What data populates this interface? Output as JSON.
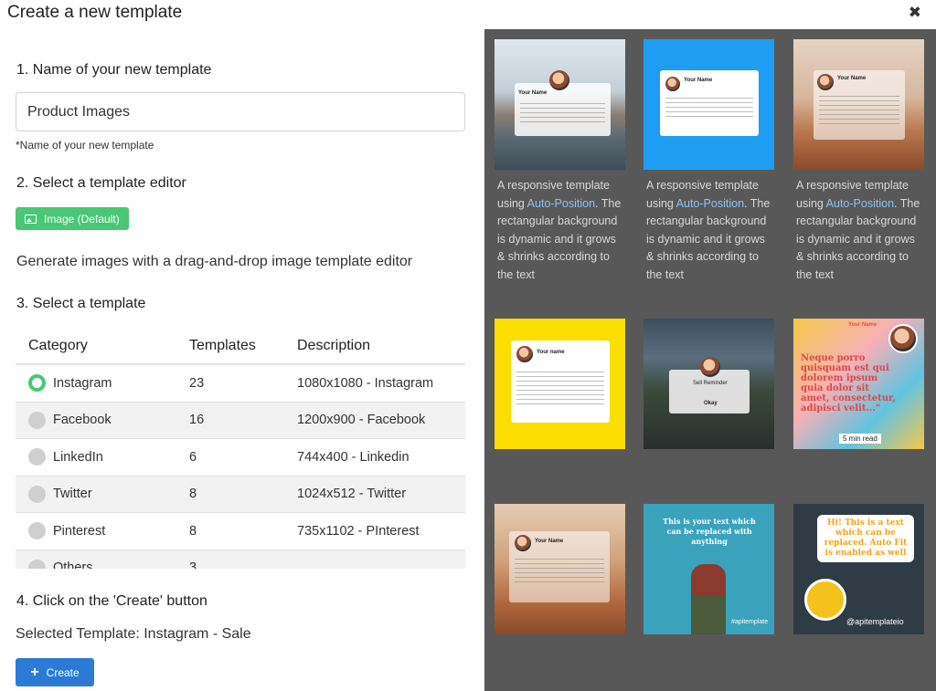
{
  "modal": {
    "title": "Create a new template",
    "close_icon": "close-icon"
  },
  "step1": {
    "heading": "1. Name of your new template",
    "input_value": "Product Images",
    "hint": "*Name of your new template"
  },
  "step2": {
    "heading": "2. Select a template editor",
    "editor_button": "Image (Default)",
    "description": "Generate images with a drag-and-drop image template editor"
  },
  "step3": {
    "heading": "3. Select a template",
    "columns": [
      "Category",
      "Templates",
      "Description"
    ],
    "rows": [
      {
        "category": "Instagram",
        "count": "23",
        "description": "1080x1080 - Instagram",
        "selected": true
      },
      {
        "category": "Facebook",
        "count": "16",
        "description": "1200x900 - Facebook",
        "selected": false
      },
      {
        "category": "LinkedIn",
        "count": "6",
        "description": "744x400 - Linkedin",
        "selected": false
      },
      {
        "category": "Twitter",
        "count": "8",
        "description": "1024x512 - Twitter",
        "selected": false
      },
      {
        "category": "Pinterest",
        "count": "8",
        "description": "735x1102 - PInterest",
        "selected": false
      },
      {
        "category": "Others",
        "count": "3",
        "description": "",
        "selected": false
      }
    ]
  },
  "step4": {
    "heading": "4. Click on the 'Create' button",
    "selected_label": "Selected Template: Instagram - Sale",
    "create_button": "Create"
  },
  "gallery": {
    "card_text": {
      "pre": "A responsive template using ",
      "link": "Auto-Position",
      "post": ". The rectangular background is dynamic and it grows & shrinks according to the text"
    },
    "thumb_text": {
      "your_name": "Your Name",
      "handle": "@twitter_name",
      "your_name_lower": "Your name",
      "handle2": "@twitter_account",
      "notif_title": "Sell Reminder",
      "notif_ok": "Okay",
      "quote": "Neque porro quisquam est qui dolorem ipsum quia dolor sit amet, consectetur, adipisci velit...\"",
      "min_read": "5 min read",
      "replace_text": "This is your text which can be replaced with anything",
      "hashtag": "#apitemplate",
      "hi_text": "Hi! This is a text which can be replaced. Auto Fit is enabled as well",
      "handle3": "@apitemplateio"
    }
  },
  "colors": {
    "green": "#48c774",
    "blue": "#2b7bd6",
    "gallery_bg": "#585858",
    "link": "#8fc3f2"
  }
}
